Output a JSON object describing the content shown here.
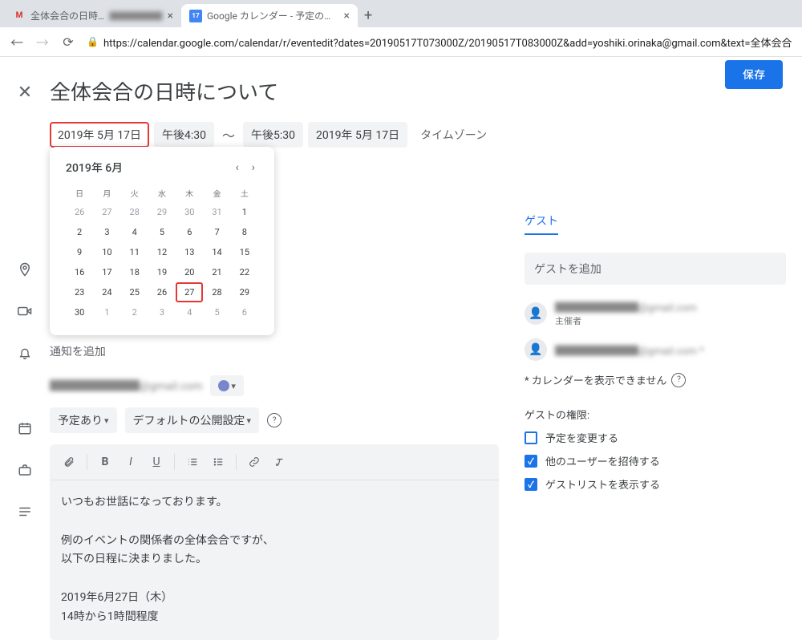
{
  "browser": {
    "tabs": [
      {
        "title": "全体会合の日時について - ",
        "favicon": "gmail"
      },
      {
        "title": "Google カレンダー - 予定の詳細",
        "favicon": "gcal"
      }
    ],
    "active_tab_index": 1,
    "url": "https://calendar.google.com/calendar/r/eventedit?dates=20190517T073000Z/20190517T083000Z&add=yoshiki.orinaka@gmail.com&text=全体会合"
  },
  "event": {
    "title": "全体会合の日時について",
    "save_label": "保存",
    "start_date": "2019年 5月 17日",
    "start_time": "午後4:30",
    "separator": "〜",
    "end_time": "午後5:30",
    "end_date": "2019年 5月 17日",
    "timezone_label": "タイムゾーン"
  },
  "calendar": {
    "month_label": "2019年 6月",
    "dows": [
      "日",
      "月",
      "火",
      "水",
      "木",
      "金",
      "土"
    ],
    "weeks": [
      [
        {
          "d": "26",
          "o": true
        },
        {
          "d": "27",
          "o": true
        },
        {
          "d": "28",
          "o": true
        },
        {
          "d": "29",
          "o": true
        },
        {
          "d": "30",
          "o": true
        },
        {
          "d": "31",
          "o": true
        },
        {
          "d": "1"
        }
      ],
      [
        {
          "d": "2"
        },
        {
          "d": "3"
        },
        {
          "d": "4"
        },
        {
          "d": "5"
        },
        {
          "d": "6"
        },
        {
          "d": "7"
        },
        {
          "d": "8"
        }
      ],
      [
        {
          "d": "9"
        },
        {
          "d": "10"
        },
        {
          "d": "11"
        },
        {
          "d": "12"
        },
        {
          "d": "13"
        },
        {
          "d": "14"
        },
        {
          "d": "15"
        }
      ],
      [
        {
          "d": "16"
        },
        {
          "d": "17"
        },
        {
          "d": "18"
        },
        {
          "d": "19"
        },
        {
          "d": "20"
        },
        {
          "d": "21"
        },
        {
          "d": "22"
        }
      ],
      [
        {
          "d": "23"
        },
        {
          "d": "24"
        },
        {
          "d": "25"
        },
        {
          "d": "26"
        },
        {
          "d": "27",
          "mark": true
        },
        {
          "d": "28"
        },
        {
          "d": "29"
        }
      ],
      [
        {
          "d": "30"
        },
        {
          "d": "1",
          "o": true
        },
        {
          "d": "2",
          "o": true
        },
        {
          "d": "3",
          "o": true
        },
        {
          "d": "4",
          "o": true
        },
        {
          "d": "5",
          "o": true
        },
        {
          "d": "6",
          "o": true
        }
      ]
    ]
  },
  "add_notification": "通知を追加",
  "organizer_email_masked": "████████@gmail.com",
  "availability": {
    "label": "予定あり",
    "visibility": "デフォルトの公開設定"
  },
  "description": "いつもお世話になっております。\n\n例のイベントの関係者の全体会合ですが、\n以下の日程に決まりました。\n\n2019年6月27日（木）\n14時から1時間程度",
  "side": {
    "tab": "ゲスト",
    "add_guest_placeholder": "ゲストを追加",
    "guests": [
      {
        "email_masked": "████████@gmail.com",
        "sub": "主催者"
      },
      {
        "email_masked": "████████@gmail.com *",
        "sub": ""
      }
    ],
    "warning": "* カレンダーを表示できません",
    "perms_header": "ゲストの権限:",
    "perms": [
      {
        "label": "予定を変更する",
        "checked": false
      },
      {
        "label": "他のユーザーを招待する",
        "checked": true
      },
      {
        "label": "ゲストリストを表示する",
        "checked": true
      }
    ]
  }
}
